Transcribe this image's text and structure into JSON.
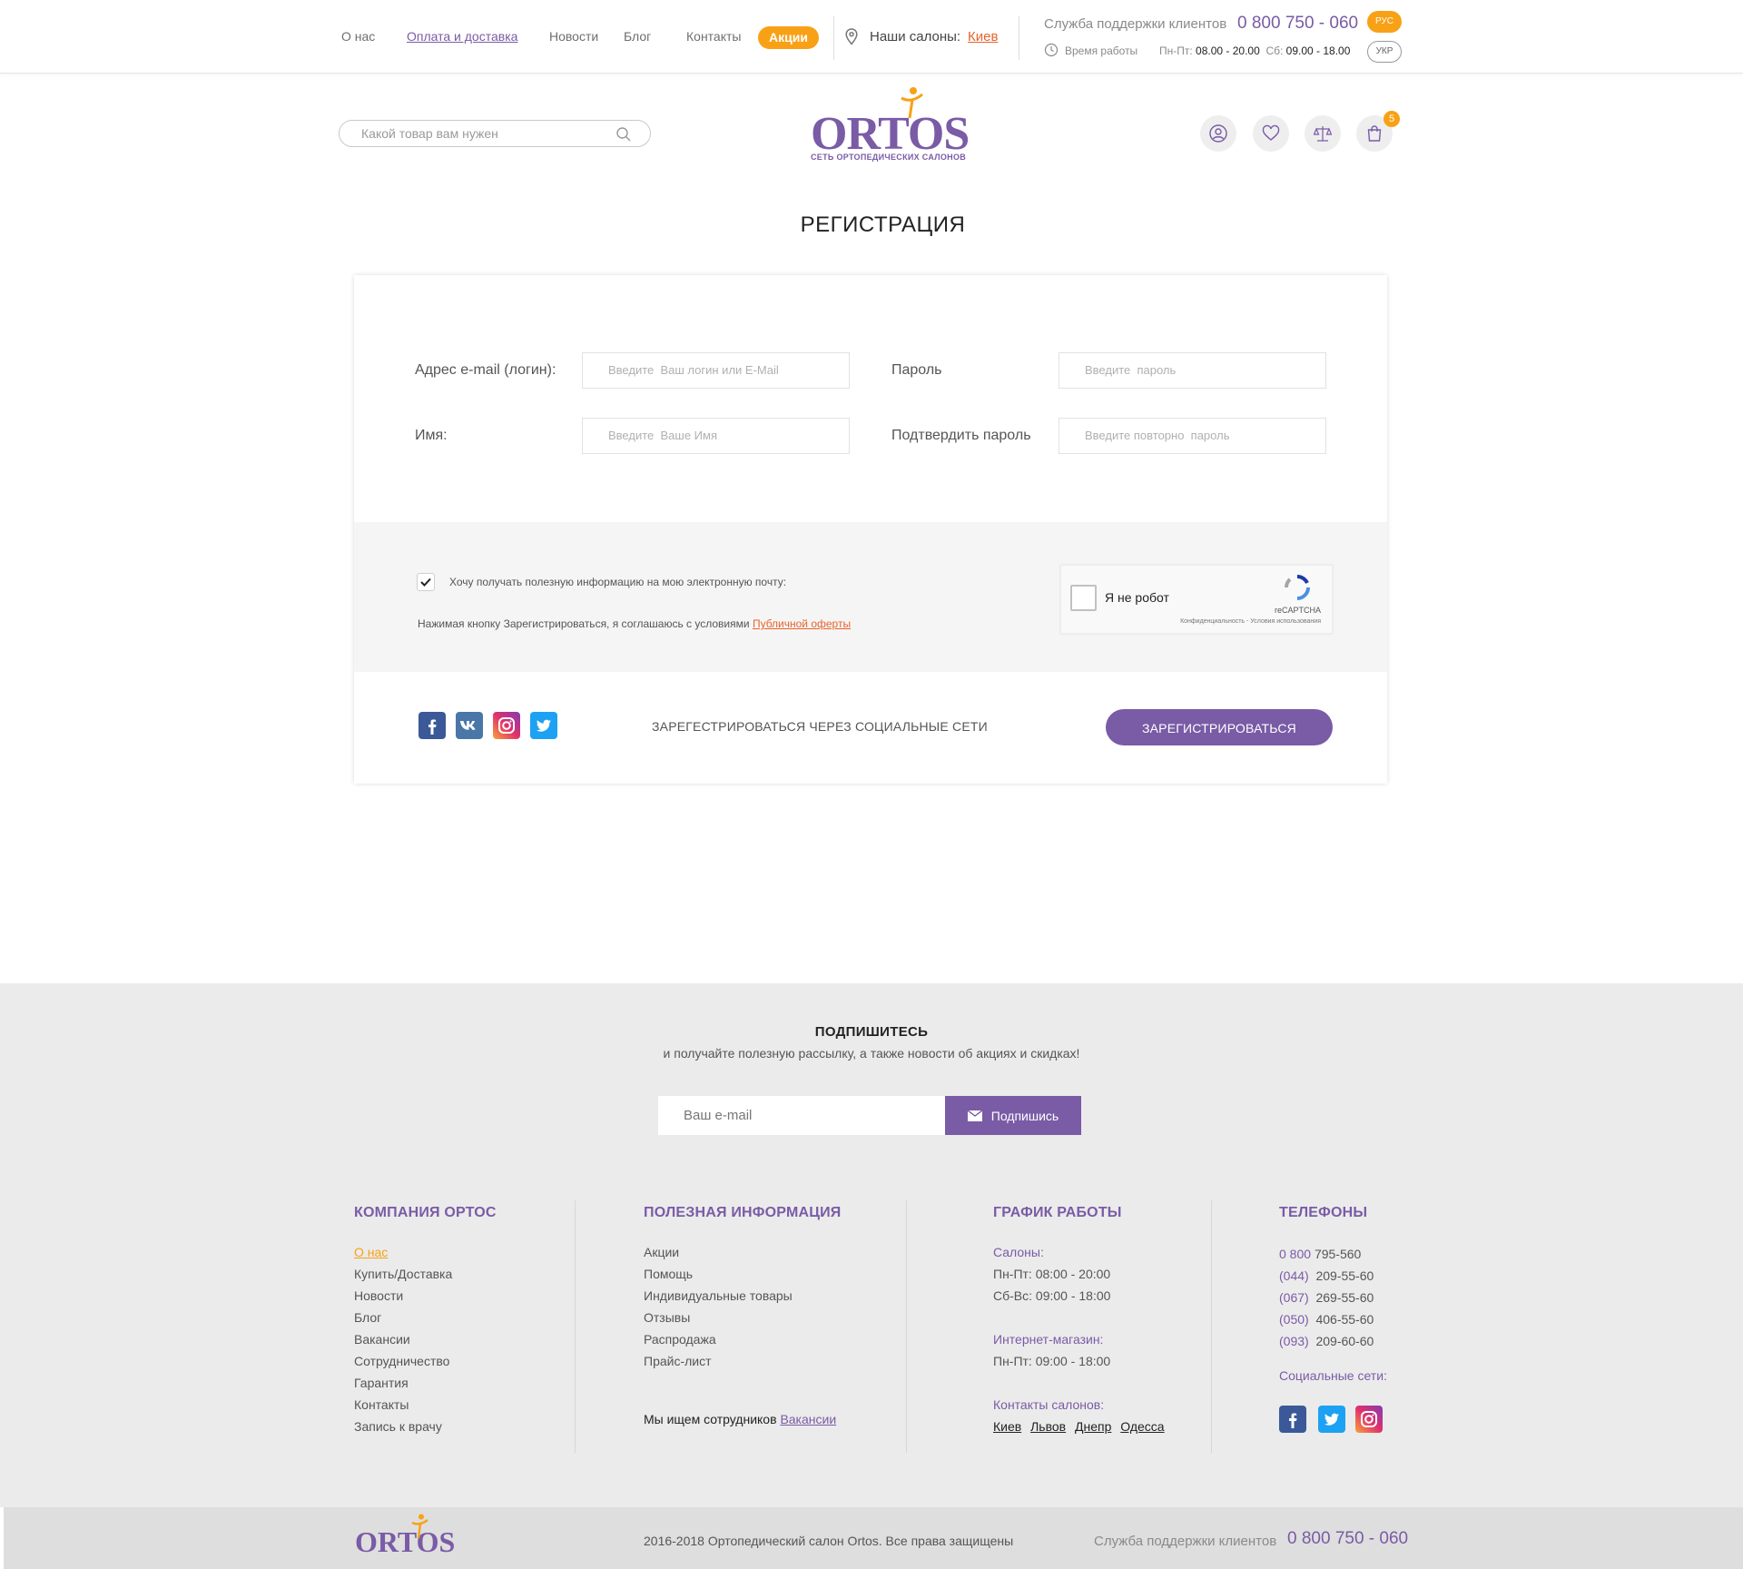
{
  "topbar": {
    "nav": [
      {
        "label": "О нас"
      },
      {
        "label": "Оплата и доставка"
      },
      {
        "label": "Новости"
      },
      {
        "label": "Блог"
      },
      {
        "label": "Контакты"
      }
    ],
    "sale_label": "Акции",
    "salons_label": "Наши салоны:",
    "salons_city": "Киев",
    "support_label": "Служба поддержки клиентов",
    "support_phone": "0 800 750 - 060",
    "hours_label": "Время работы",
    "hours_weekday_label": "Пн-Пт:",
    "hours_weekday": "08.00 - 20.00",
    "hours_sat_label": "Сб:",
    "hours_sat": "09.00 - 18.00",
    "lang_active": "РУС",
    "lang_other": "УКР"
  },
  "header": {
    "search_placeholder": "Какой товар вам нужен",
    "logo_text": "ORTOS",
    "logo_subtitle": "СЕТЬ ОРТОПЕДИЧЕСКИХ САЛОНОВ",
    "cart_count": "5",
    "icons": [
      "user-icon",
      "heart-icon",
      "scales-icon",
      "bag-icon"
    ]
  },
  "registration": {
    "title": "РЕГИСТРАЦИЯ",
    "email_label": "Адрес e-mail (логин):",
    "email_placeholder": "Введите  Ваш логин или E-Mail",
    "name_label": "Имя:",
    "name_placeholder": "Введите  Ваше Имя",
    "password_label": "Пароль",
    "password_placeholder": "Введите  пароль",
    "confirm_label": "Подтвердить пароль",
    "confirm_placeholder": "Введите повторно  пароль",
    "newsletter_checked": true,
    "newsletter_label": "Хочу получать полезную информацию на мою электронную почту:",
    "terms_text": "Нажимая кнопку Зарегистрироваться, я соглашаюсь с условиями",
    "terms_link": "Публичной оферты",
    "captcha_label": "Я не робот",
    "captcha_brand": "reCAPTCHA",
    "captcha_fine": "Конфиденциальность - Условия использования",
    "social_text": "ЗАРЕГЕСТРИРОВАТЬСЯ  ЧЕРЕЗ СОЦИАЛЬНЫЕ СЕТИ",
    "social_icons": [
      "facebook-icon",
      "vk-icon",
      "instagram-icon",
      "twitter-icon"
    ],
    "submit_label": "ЗАРЕГИСТРИРОВАТЬСЯ"
  },
  "subscribe": {
    "title": "ПОДПИШИТЕСЬ",
    "description": "и получайте полезную рассылку, а также новости об акциях и скидках!",
    "placeholder": "Ваш e-mail",
    "button": "Подпишись"
  },
  "footer": {
    "company": {
      "title": "КОМПАНИЯ ОРТОС",
      "items": [
        "О нас",
        "Купить/Доставка",
        "Новости",
        "Блог",
        "Вакансии",
        "Сотрудничество",
        "Гарантия",
        "Контакты",
        "Запись к врачу"
      ]
    },
    "info": {
      "title": "ПОЛЕЗНАЯ ИНФОРМАЦИЯ",
      "items": [
        "Акции",
        "Помощь",
        "Индивидуальные товары",
        "Отзывы",
        "Распродажа",
        "Прайс-лист"
      ],
      "jobs_text": "Мы ищем сотрудников",
      "jobs_link": "Вакансии"
    },
    "schedule": {
      "title": "ГРАФИК РАБОТЫ",
      "salons_label": "Салоны:",
      "salons_weekday": "Пн-Пт: 08:00 - 20:00",
      "salons_weekend": "Сб-Вс: 09:00 - 18:00",
      "shop_label": "Интернет-магазин:",
      "shop_hours": "Пн-Пт: 09:00 - 18:00",
      "contacts_label": "Контакты салонов:",
      "cities": [
        "Киев",
        "Львов",
        "Днепр",
        "Одесса"
      ]
    },
    "phones": {
      "title": "ТЕЛЕФОНЫ",
      "list": [
        {
          "code": "0 800",
          "number": "795-560"
        },
        {
          "code": "(044)",
          "number": "209-55-60"
        },
        {
          "code": "(067)",
          "number": "269-55-60"
        },
        {
          "code": "(050)",
          "number": "406-55-60"
        },
        {
          "code": "(093)",
          "number": "209-60-60"
        }
      ],
      "social_label": "Социальные сети:"
    }
  },
  "bottom": {
    "logo_text": "ORTOS",
    "copyright": "2016-2018  Ортопедический салон Ortos. Все права защищены",
    "support_label": "Служба поддержки клиентов",
    "support_phone": "0 800 750 - 060"
  },
  "colors": {
    "brand_purple": "#7a5ba6",
    "accent_orange": "#f8a116",
    "link_red": "#e7632c"
  }
}
